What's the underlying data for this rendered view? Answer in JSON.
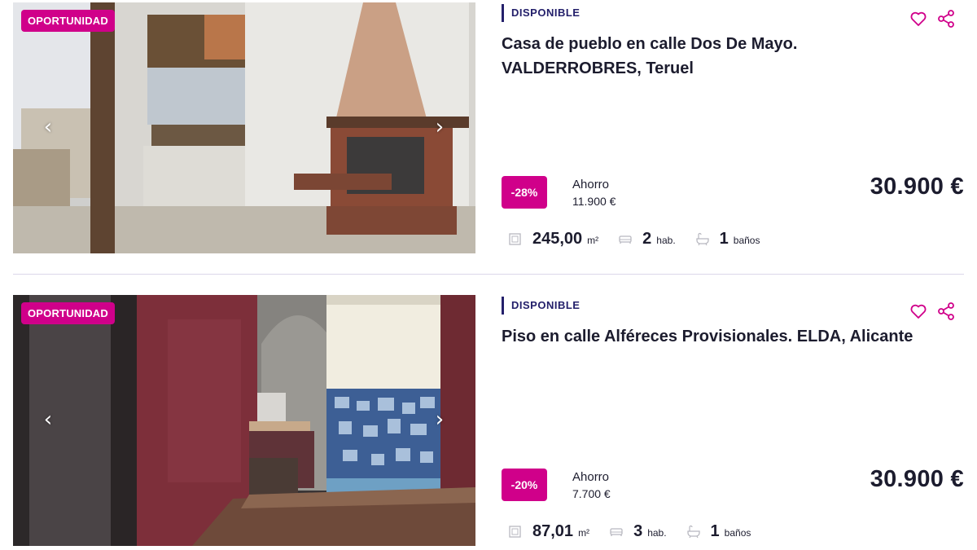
{
  "listings": [
    {
      "badge": "OPORTUNIDAD",
      "status": "DISPONIBLE",
      "title": "Casa de pueblo en calle Dos De Mayo. VALDERROBRES, Teruel",
      "discount": "-28%",
      "savings_label": "Ahorro",
      "savings_value": "11.900 €",
      "price": "30.900 €",
      "area_value": "245,00",
      "area_unit": "m²",
      "rooms_value": "2",
      "rooms_unit": "hab.",
      "baths_value": "1",
      "baths_unit": "baños"
    },
    {
      "badge": "OPORTUNIDAD",
      "status": "DISPONIBLE",
      "title": "Piso en calle Alféreces Provisionales. ELDA, Alicante",
      "discount": "-20%",
      "savings_label": "Ahorro",
      "savings_value": "7.700 €",
      "price": "30.900 €",
      "area_value": "87,01",
      "area_unit": "m²",
      "rooms_value": "3",
      "rooms_unit": "hab.",
      "baths_value": "1",
      "baths_unit": "baños"
    }
  ],
  "icons": {
    "prev": "chevron-left-icon",
    "next": "chevron-right-icon",
    "favorite": "heart-icon",
    "share": "share-icon",
    "area": "area-icon",
    "rooms": "bed-icon",
    "baths": "bathtub-icon"
  },
  "colors": {
    "accent": "#d0008a",
    "status": "#24206b",
    "text": "#1c1c2e",
    "divider": "#dcd6ea"
  }
}
